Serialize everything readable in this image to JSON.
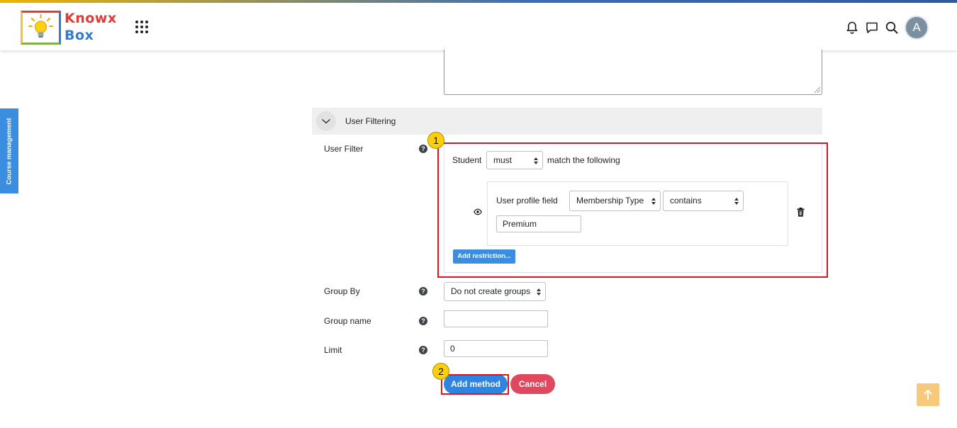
{
  "header": {
    "logo_line1": "Knowx",
    "logo_line2": "Box",
    "avatar_letter": "A"
  },
  "sidebar": {
    "course_management_label": "Course management"
  },
  "section": {
    "title": "User Filtering"
  },
  "form": {
    "user_filter_label": "User Filter",
    "filter": {
      "subject": "Student",
      "operator_selected": "must",
      "suffix": "match the following",
      "condition": {
        "label": "User profile field",
        "field_selected": "Membership Type",
        "comparison_selected": "contains",
        "value": "Premium"
      },
      "add_restriction_label": "Add restriction..."
    },
    "group_by_label": "Group By",
    "group_by_selected": "Do not create groups",
    "group_name_label": "Group name",
    "group_name_value": "",
    "limit_label": "Limit",
    "limit_value": "0",
    "add_method_label": "Add method",
    "cancel_label": "Cancel"
  },
  "annotations": {
    "step1": "1",
    "step2": "2"
  },
  "colors": {
    "primary": "#2f84e0",
    "cancel": "#e04860",
    "highlight": "#e0141e",
    "step_badge": "#fbcf0c",
    "back_to_top": "#f6c97b"
  }
}
